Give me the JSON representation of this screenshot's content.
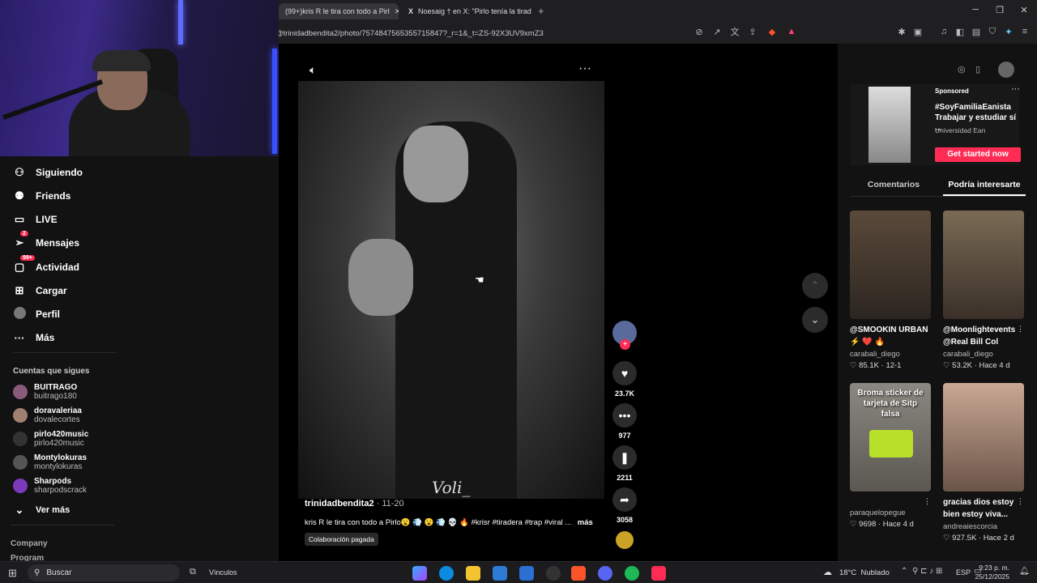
{
  "browser": {
    "tabs": [
      {
        "label": "(99+)kris R le tira con todo a Pirl"
      },
      {
        "label": "Noesaig † en X: \"Pirlo tenía la tirad"
      }
    ],
    "url": "@trinidadbendita2/photo/7574847565355715847?_r=1&_t=ZS-92X3UV9xmZ3"
  },
  "sidebar": {
    "nav": [
      {
        "label": "Siguiendo",
        "icon": "following-icon"
      },
      {
        "label": "Friends",
        "icon": "friends-icon"
      },
      {
        "label": "LIVE",
        "icon": "live-icon"
      },
      {
        "label": "Mensajes",
        "icon": "messages-icon",
        "badge": "2"
      },
      {
        "label": "Actividad",
        "icon": "activity-icon",
        "badge": "99+"
      },
      {
        "label": "Cargar",
        "icon": "upload-icon"
      },
      {
        "label": "Perfil",
        "icon": "profile-icon"
      },
      {
        "label": "Más",
        "icon": "more-icon"
      }
    ],
    "following_heading": "Cuentas que sigues",
    "accounts": [
      {
        "name": "BUITRAGO",
        "handle": "buitrago180"
      },
      {
        "name": "doravaleriaa",
        "handle": "dovalecortes"
      },
      {
        "name": "pirlo420music",
        "handle": "pirlo420music"
      },
      {
        "name": "Montylokuras",
        "handle": "montylokuras"
      },
      {
        "name": "Sharpods",
        "handle": "sharpodscrack"
      }
    ],
    "see_more": "Ver más",
    "footer": [
      "Company",
      "Program"
    ]
  },
  "post": {
    "author": "trinidadbendita2",
    "date": "· 11-20",
    "caption": "kris R le tira con todo a Pirlo😮 💨 😮 💨 💀 🔥 #krisr #tiradera #trap #viral ...",
    "more": "más",
    "paid_label": "Colaboración pagada",
    "watermark": "Voli_",
    "likes": "23.7K",
    "comments": "977",
    "saves": "2211",
    "shares": "3058"
  },
  "right": {
    "sponsored": "Sponsored",
    "ad_title": "#SoyFamiliaEanista Trabajar y estudiar sí ...",
    "ad_brand": "Universidad Ean",
    "ad_cta": "Get started now",
    "tabs": [
      "Comentarios",
      "Podría interesarte"
    ],
    "cards": [
      {
        "title": "@SMOOKIN URBAN ⚡ ❤️ 🔥",
        "user": "carabali_diego",
        "likes": "85.1K",
        "when": "12-1"
      },
      {
        "title": "@Moonlightevents @Real Bill Col",
        "user": "carabali_diego",
        "likes": "53.2K",
        "when": "Hace 4 d"
      },
      {
        "title": "",
        "overlay": "Broma sticker de tarjeta de Sitp falsa",
        "user": "paraquelopegue",
        "likes": "9698",
        "when": "Hace 4 d"
      },
      {
        "title": "gracias dios estoy bien estoy viva...",
        "user": "andreaiescorcia",
        "likes": "927.5K",
        "when": "Hace 2 d"
      }
    ]
  },
  "taskbar": {
    "search": "Buscar",
    "links": "Vínculos",
    "weather": "18°C  Nublado",
    "lang": "ESP",
    "time": "9:23 p. m.",
    "date": "25/12/2025"
  }
}
